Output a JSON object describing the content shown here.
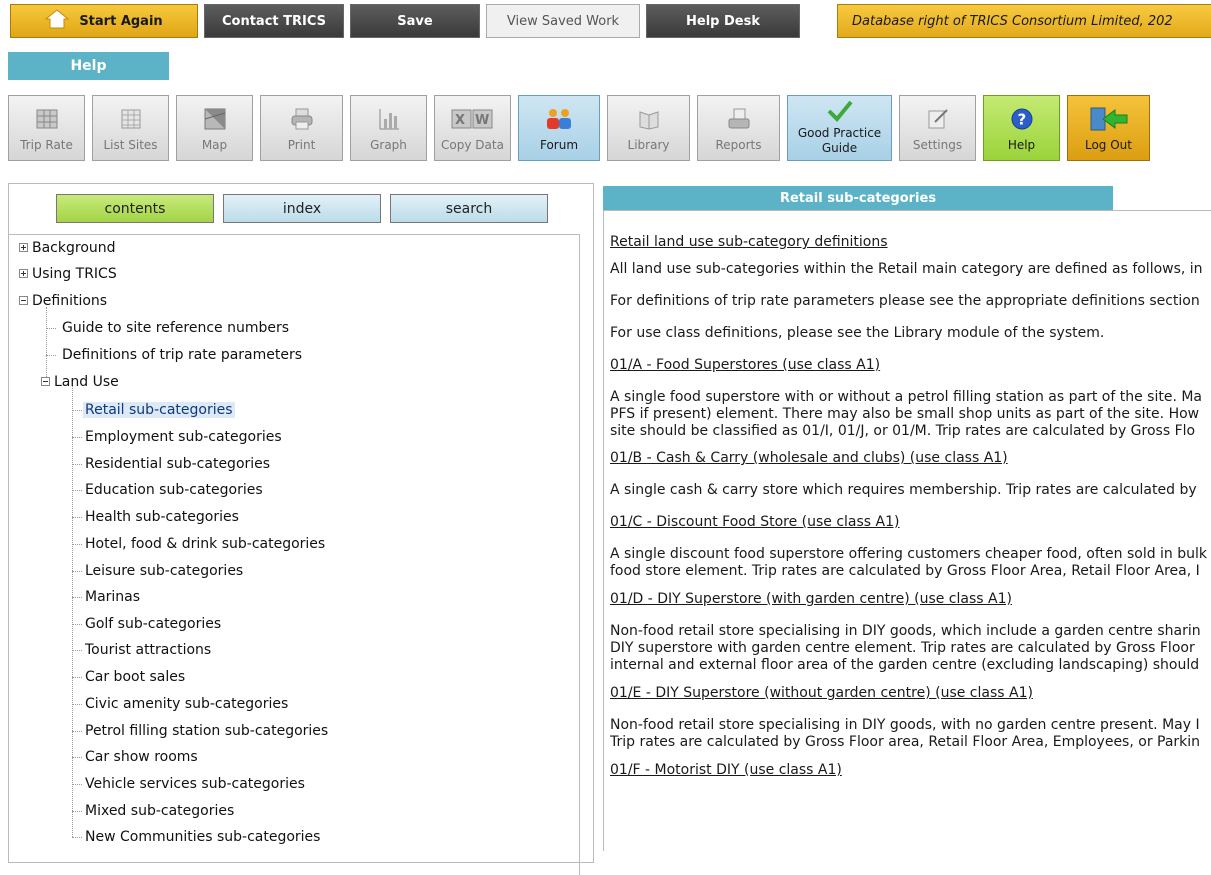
{
  "topbar": {
    "start_again": "Start Again",
    "contact": "Contact TRICS",
    "save": "Save",
    "view_saved": "View Saved Work",
    "help_desk": "Help Desk",
    "database_right": "Database right of TRICS Consortium Limited, 202"
  },
  "help_tab": "Help",
  "toolbar": [
    {
      "label": "Trip Rate",
      "icon": "trip-rate-icon"
    },
    {
      "label": "List Sites",
      "icon": "list-sites-icon"
    },
    {
      "label": "Map",
      "icon": "map-icon"
    },
    {
      "label": "Print",
      "icon": "printer-icon"
    },
    {
      "label": "Graph",
      "icon": "graph-icon"
    },
    {
      "label": "Copy Data",
      "icon": "copy-data-icon"
    },
    {
      "label": "Forum",
      "icon": "forum-icon"
    },
    {
      "label": "Library",
      "icon": "library-icon"
    },
    {
      "label": "Reports",
      "icon": "reports-icon"
    },
    {
      "label": "Good Practice Guide",
      "line1": "Good Practice",
      "line2": "Guide",
      "icon": "checkmark-icon"
    },
    {
      "label": "Settings",
      "icon": "settings-icon"
    },
    {
      "label": "Help",
      "icon": "help-icon"
    },
    {
      "label": "Log Out",
      "icon": "log-out-icon"
    }
  ],
  "left_tabs": {
    "contents": "contents",
    "index": "index",
    "search": "search"
  },
  "tree": {
    "background": "Background",
    "using": "Using TRICS",
    "definitions": "Definitions",
    "guide_ref": "Guide to site reference numbers",
    "trip_params": "Definitions of trip rate parameters",
    "land_use": "Land Use",
    "items": [
      "Retail sub-categories",
      "Employment sub-categories",
      "Residential sub-categories",
      "Education sub-categories",
      "Health sub-categories",
      "Hotel, food & drink sub-categories",
      "Leisure sub-categories",
      "Marinas",
      "Golf sub-categories",
      "Tourist attractions",
      "Car boot sales",
      "Civic amenity sub-categories",
      "Petrol filling station sub-categories",
      "Car show rooms",
      "Vehicle services sub-categories",
      "Mixed sub-categories",
      "New Communities sub-categories"
    ]
  },
  "right": {
    "heading": "Retail sub-categories",
    "title": "Retail land use sub-category definitions",
    "p1": "All land use sub-categories within the Retail main category are defined as follows, in",
    "p2": "For definitions of trip rate parameters please see the appropriate definitions section",
    "p3": "For use class definitions, please see the Library module of the system.",
    "s1_title": "01/A - Food Superstores (use class A1)",
    "s1_l1": "A single food superstore with or without a petrol filling station as part of the site. Ma",
    "s1_l2": "PFS if present) element. There may also be small shop units as part of the site. How",
    "s1_l3": "site should be classified as 01/I, 01/J, or 01/M. Trip rates are calculated by Gross Flo",
    "s2_title": "01/B - Cash & Carry (wholesale and clubs) (use class A1)",
    "s2_l1": "A single cash & carry store which requires membership. Trip rates are calculated by",
    "s3_title": "01/C - Discount Food Store (use class A1)",
    "s3_l1": "A single discount food superstore offering customers cheaper food, often sold in bulk",
    "s3_l2": "food store element. Trip rates are calculated by Gross Floor Area, Retail Floor Area, I",
    "s4_title": "01/D - DIY Superstore (with garden centre) (use class A1)",
    "s4_l1": "Non-food retail store specialising in DIY goods, which include a garden centre sharin",
    "s4_l2": "DIY superstore with garden centre element. Trip rates are calculated by Gross Floor",
    "s4_l3": "internal and external floor area of the garden centre (excluding landscaping) should",
    "s5_title": "01/E - DIY Superstore (without garden centre) (use class A1)",
    "s5_l1": "Non-food retail store specialising in DIY goods, with no garden centre present. May I",
    "s5_l2": "Trip rates are calculated by Gross Floor area, Retail Floor Area, Employees, or Parkin",
    "s6_title": "01/F - Motorist DIY (use class A1)"
  }
}
